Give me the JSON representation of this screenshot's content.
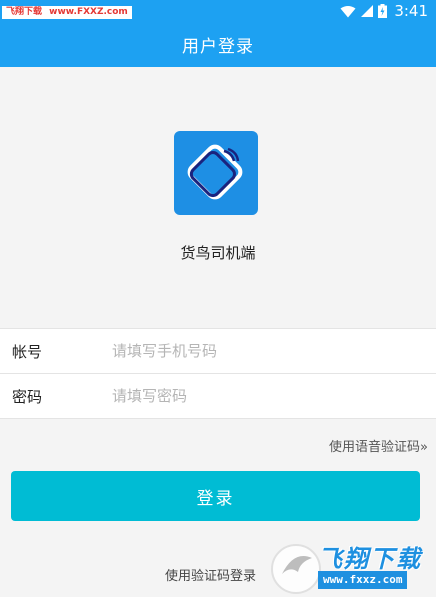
{
  "status_bar": {
    "watermark_cn": "飞翔下载",
    "watermark_url": "www.FXXZ.com",
    "time": "3:41"
  },
  "app_bar": {
    "title": "用户登录"
  },
  "brand": {
    "app_name": "货鸟司机端",
    "logo_color": "#1e8fe4"
  },
  "form": {
    "account_label": "帐号",
    "account_placeholder": "请填写手机号码",
    "password_label": "密码",
    "password_placeholder": "请填写密码"
  },
  "links": {
    "voice_code": "使用语音验证码»",
    "sms_code_login": "使用验证码登录"
  },
  "login_button": {
    "label": "登录",
    "color": "#00bcd4"
  },
  "bottom_watermark": {
    "title": "飞翔下载",
    "url": "www.fxxz.com"
  },
  "colors": {
    "primary": "#1da1f2",
    "background": "#f4f4f4"
  }
}
